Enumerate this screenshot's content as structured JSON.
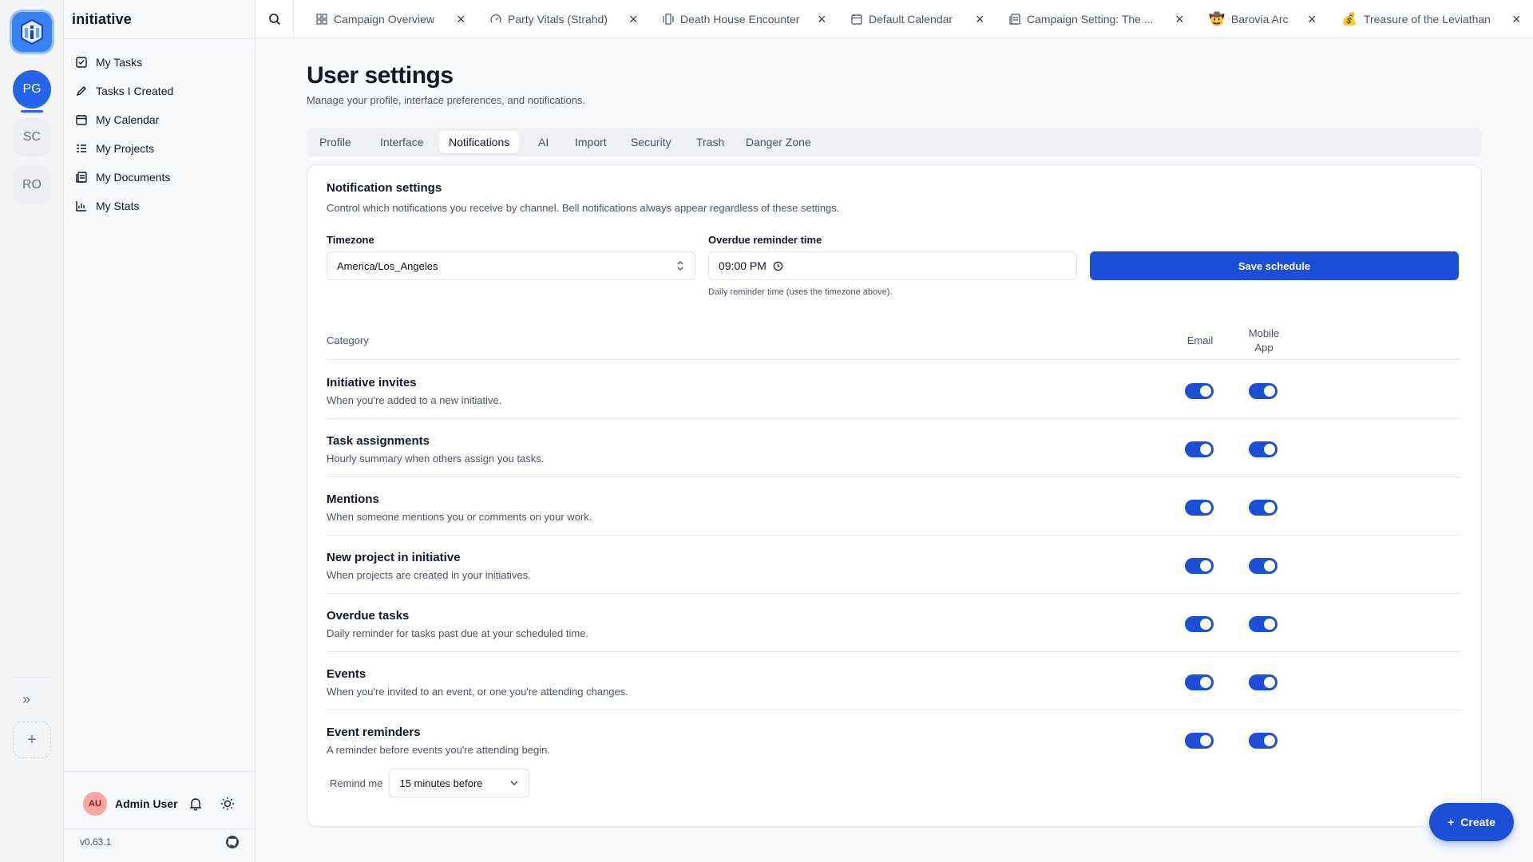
{
  "app": {
    "name": "initiative",
    "version": "v0.63.1"
  },
  "workspaces": [
    {
      "initials": "PG",
      "active": true
    },
    {
      "initials": "SC",
      "active": false
    },
    {
      "initials": "RO",
      "active": false
    }
  ],
  "sidebar": {
    "items": [
      {
        "label": "My Tasks",
        "icon": "checkbox-icon"
      },
      {
        "label": "Tasks I Created",
        "icon": "pencil-icon"
      },
      {
        "label": "My Calendar",
        "icon": "calendar-icon"
      },
      {
        "label": "My Projects",
        "icon": "list-icon"
      },
      {
        "label": "My Documents",
        "icon": "documents-icon"
      },
      {
        "label": "My Stats",
        "icon": "bar-chart-icon"
      }
    ]
  },
  "user": {
    "initials": "AU",
    "name": "Admin User"
  },
  "tabs": [
    {
      "label": "Campaign Overview",
      "icon": "grid-icon"
    },
    {
      "label": "Party Vitals (Strahd)",
      "icon": "gauge-icon"
    },
    {
      "label": "Death House Encounter",
      "icon": "columns-icon"
    },
    {
      "label": "Default Calendar",
      "icon": "calendar-icon"
    },
    {
      "label": "Campaign Setting: The ...",
      "icon": "document-icon"
    },
    {
      "label": "Barovia Arc",
      "icon": "🤠"
    },
    {
      "label": "Treasure of the Leviathan",
      "icon": "💰"
    }
  ],
  "page": {
    "title": "User settings",
    "subtitle": "Manage your profile, interface preferences, and notifications."
  },
  "settings_tabs": [
    {
      "label": "Profile",
      "active": false
    },
    {
      "label": "Interface",
      "active": false
    },
    {
      "label": "Notifications",
      "active": true
    },
    {
      "label": "AI",
      "active": false
    },
    {
      "label": "Import",
      "active": false
    },
    {
      "label": "Security",
      "active": false
    },
    {
      "label": "Trash",
      "active": false
    },
    {
      "label": "Danger Zone",
      "active": false
    }
  ],
  "notifications": {
    "title": "Notification settings",
    "subtitle": "Control which notifications you receive by channel. Bell notifications always appear regardless of these settings.",
    "timezone_label": "Timezone",
    "timezone_value": "America/Los_Angeles",
    "reminder_label": "Overdue reminder time",
    "reminder_value": "09:00 PM",
    "reminder_hint": "Daily reminder time (uses the timezone above).",
    "save_label": "Save schedule",
    "columns": {
      "category": "Category",
      "email": "Email",
      "mobile_line1": "Mobile",
      "mobile_line2": "App"
    },
    "categories": [
      {
        "title": "Initiative invites",
        "desc": "When you're added to a new initiative.",
        "email": true,
        "mobile": true
      },
      {
        "title": "Task assignments",
        "desc": "Hourly summary when others assign you tasks.",
        "email": true,
        "mobile": true
      },
      {
        "title": "Mentions",
        "desc": "When someone mentions you or comments on your work.",
        "email": true,
        "mobile": true
      },
      {
        "title": "New project in initiative",
        "desc": "When projects are created in your initiatives.",
        "email": true,
        "mobile": true
      },
      {
        "title": "Overdue tasks",
        "desc": "Daily reminder for tasks past due at your scheduled time.",
        "email": true,
        "mobile": true
      },
      {
        "title": "Events",
        "desc": "When you're invited to an event, or one you're attending changes.",
        "email": true,
        "mobile": true
      },
      {
        "title": "Event reminders",
        "desc": "A reminder before events you're attending begin.",
        "email": true,
        "mobile": true
      }
    ],
    "remind_label": "Remind me",
    "remind_value": "15 minutes before"
  },
  "create_label": "Create",
  "colors": {
    "accent": "#1d4ed8",
    "workspace_active": "#2563eb",
    "avatar": "#fca5a5"
  }
}
